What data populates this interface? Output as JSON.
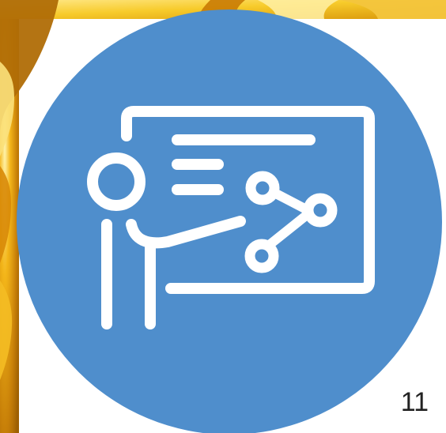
{
  "slide": {
    "page_number": "11",
    "icon": "presentation-teacher-chart-icon"
  },
  "colors": {
    "circle_fill": "#4f8ecc",
    "icon_stroke": "#ffffff",
    "background": "#ffffff",
    "gold_corner_dark": "#b97705",
    "gold_corner_light": "#f7c93e"
  }
}
